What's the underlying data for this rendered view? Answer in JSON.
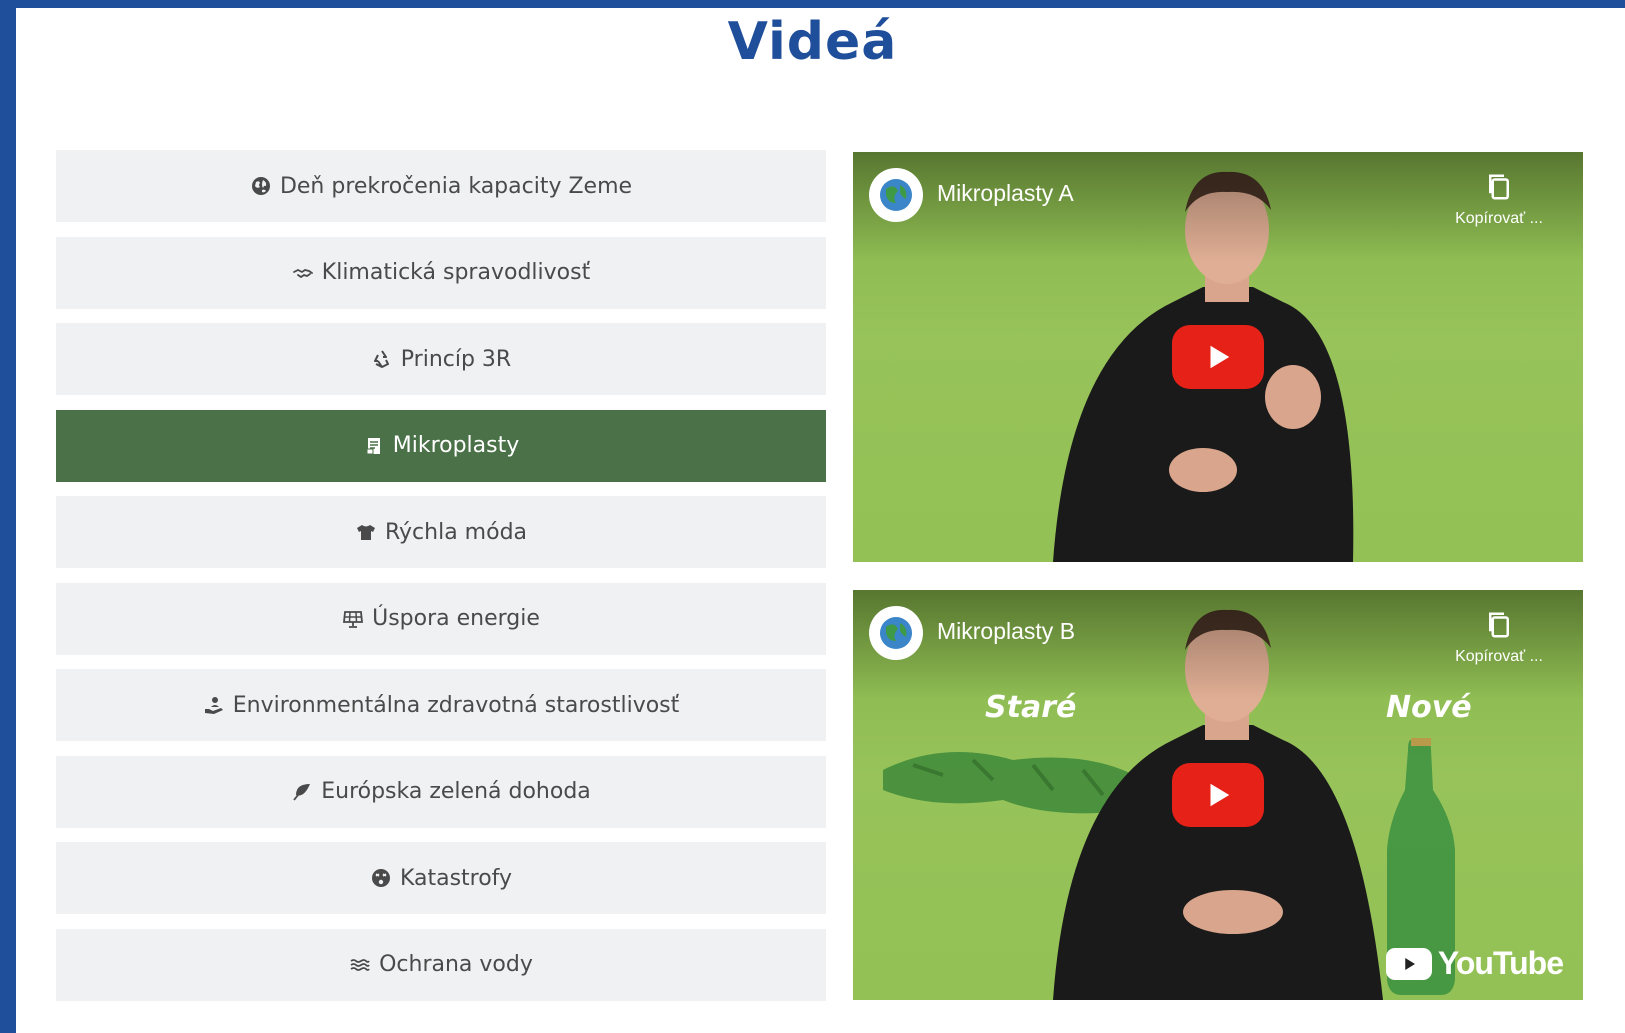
{
  "page": {
    "title": "Videá"
  },
  "colors": {
    "brand": "#1f4e9a",
    "active_topic": "#4a7148",
    "topic_bg": "#f0f1f3",
    "play": "#e62117",
    "video_green": "#93c155"
  },
  "topics": [
    {
      "label": "Deň prekročenia kapacity Zeme",
      "icon": "earth-icon",
      "active": false
    },
    {
      "label": "Klimatická spravodlivosť",
      "icon": "handshake-icon",
      "active": false
    },
    {
      "label": "Princíp 3R",
      "icon": "recycle-icon",
      "active": false
    },
    {
      "label": "Mikroplasty",
      "icon": "document-icon",
      "active": true
    },
    {
      "label": "Rýchla móda",
      "icon": "tshirt-icon",
      "active": false
    },
    {
      "label": "Úspora energie",
      "icon": "solar-panel-icon",
      "active": false
    },
    {
      "label": "Environmentálna zdravotná starostlivosť",
      "icon": "hand-holding-person-icon",
      "active": false
    },
    {
      "label": "Európska zelená dohoda",
      "icon": "leaf-icon",
      "active": false
    },
    {
      "label": "Katastrofy",
      "icon": "angry-face-icon",
      "active": false
    },
    {
      "label": "Ochrana vody",
      "icon": "water-icon",
      "active": false
    }
  ],
  "videos": [
    {
      "title": "Mikroplasty A",
      "copy_label": "Kopírovať ...",
      "overlay_left": "",
      "overlay_right": "",
      "yt_logo": ""
    },
    {
      "title": "Mikroplasty B",
      "copy_label": "Kopírovať ...",
      "overlay_left": "Staré",
      "overlay_right": "Nové",
      "yt_logo": "YouTube"
    }
  ]
}
